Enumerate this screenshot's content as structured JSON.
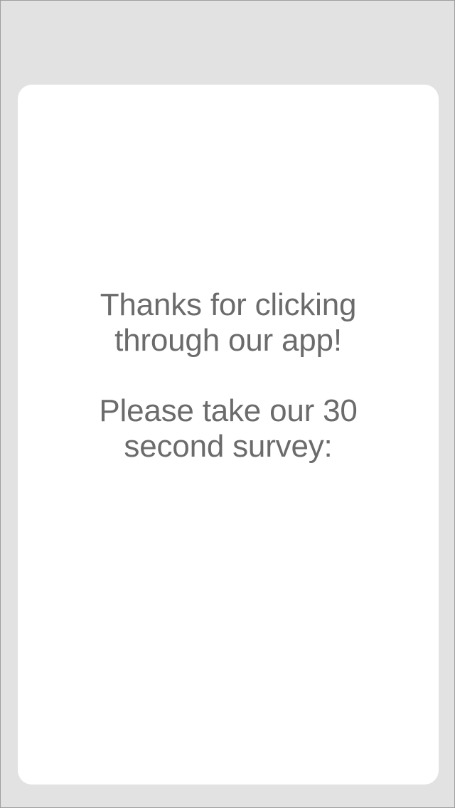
{
  "card": {
    "thanks_lines": [
      "Thanks for clicking",
      "through our app!"
    ],
    "survey_lines": [
      "Please take our 30",
      "second survey:"
    ]
  },
  "colors": {
    "background": "#e2e2e2",
    "card": "#ffffff",
    "text": "#6b6b6b"
  }
}
